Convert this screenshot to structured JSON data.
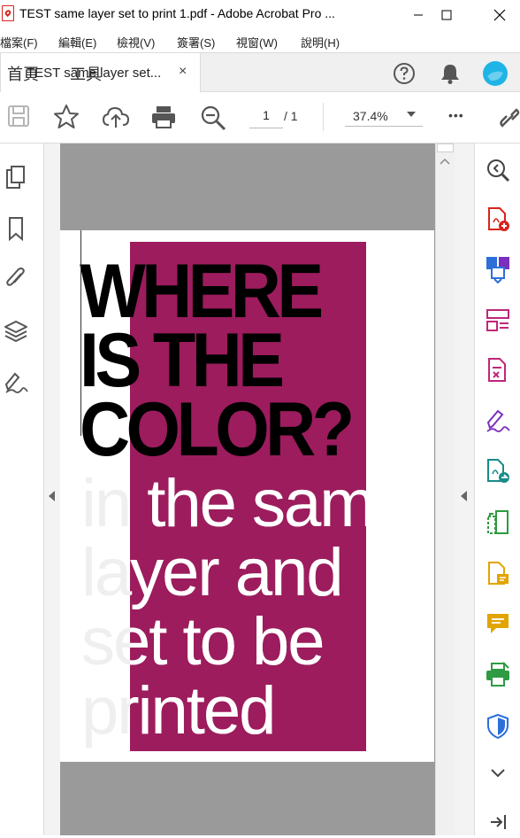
{
  "window": {
    "title": "TEST same layer set to print 1.pdf - Adobe Acrobat Pro ..."
  },
  "menu": [
    "檔案(F)",
    "編輯(E)",
    "檢視(V)",
    "簽署(S)",
    "視窗(W)",
    "說明(H)"
  ],
  "tabs": {
    "home": "首頁",
    "tools": "工具",
    "document": "TEST same layer set...",
    "close_symbol": "×"
  },
  "header_icons": [
    "help-icon",
    "bell-icon",
    "profile-avatar"
  ],
  "toolbar": {
    "icons": [
      "save-icon",
      "bookmark-star-icon",
      "cloud-upload-icon",
      "print-icon",
      "zoom-out-icon"
    ],
    "page_current": "1",
    "page_total": "/ 1",
    "zoom": "37.4%",
    "more": "•••"
  },
  "left_sidebar_icons": [
    "page-thumbnails-icon",
    "bookmarks-icon",
    "attachments-icon",
    "layers-icon",
    "signature-icon"
  ],
  "right_sidebar_icons": [
    "search-zoom-icon",
    "create-pdf-icon",
    "combine-files-icon",
    "organize-pages-icon",
    "export-pdf-icon",
    "edit-pdf-icon",
    "send-for-review-icon",
    "compress-icon",
    "fill-sign-icon",
    "comment-icon",
    "print-production-icon",
    "protect-icon",
    "more-tools-icon",
    "collapse-panel-icon"
  ],
  "document": {
    "headline": [
      "WHERE",
      "IS THE",
      "COLOR?"
    ],
    "subtext": [
      "in the same",
      "layer and",
      "set to be",
      "printed"
    ]
  },
  "colors": {
    "magenta": "#9c1c5d",
    "acrobat_red": "#d9231c",
    "tool_purple": "#7b2fbf",
    "tool_blue": "#2d6fd9",
    "tool_green": "#2e9b42",
    "tool_yellow": "#e2a400"
  }
}
